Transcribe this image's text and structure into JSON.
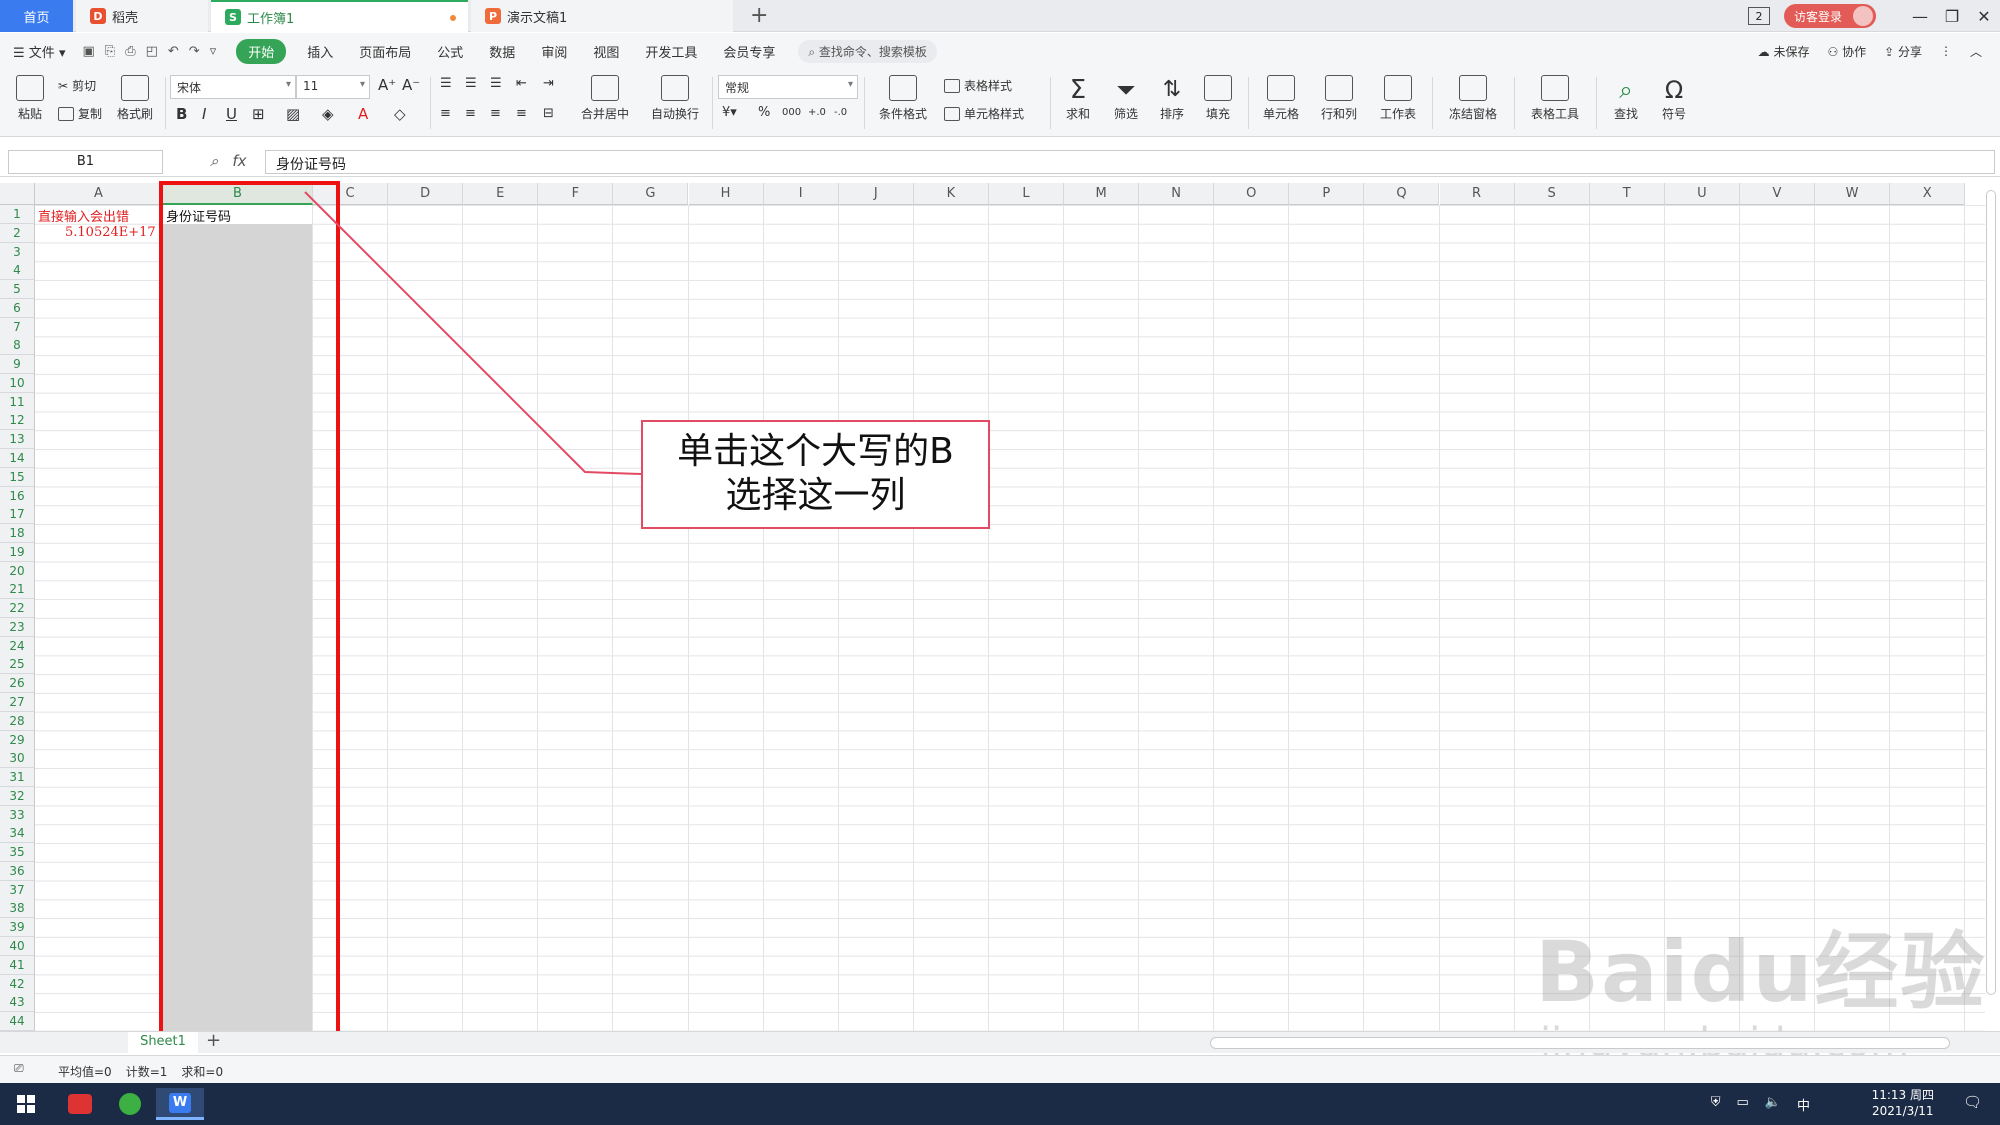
{
  "tabs": {
    "home": "首页",
    "daoke": "稻壳",
    "workbook": "工作簿1",
    "presentation": "演示文稿1",
    "add": "+"
  },
  "window": {
    "badge": "2",
    "login": "访客登录",
    "minimize": "—",
    "restore": "❐",
    "close": "✕"
  },
  "menu": {
    "file": "文件",
    "items": [
      "开始",
      "插入",
      "页面布局",
      "公式",
      "数据",
      "审阅",
      "视图",
      "开发工具",
      "会员专享"
    ],
    "search": "查找命令、搜索模板",
    "unsaved": "未保存",
    "collab": "协作",
    "share": "分享"
  },
  "ribbon": {
    "paste": "粘贴",
    "cut": "剪切",
    "copy": "复制",
    "format_painter": "格式刷",
    "font_name": "宋体",
    "font_size": "11",
    "number_format": "常规",
    "merge_center": "合并居中",
    "wrap": "自动换行",
    "cond_format": "条件格式",
    "table_style": "表格样式",
    "cell_style": "单元格样式",
    "sum": "求和",
    "filter": "筛选",
    "sort": "排序",
    "fill": "填充",
    "cell": "单元格",
    "row_col": "行和列",
    "worksheet": "工作表",
    "freeze": "冻结窗格",
    "table_tools": "表格工具",
    "find": "查找",
    "symbol": "符号",
    "bold": "B",
    "italic": "I",
    "underline": "U"
  },
  "formula_bar": {
    "cell_ref": "B1",
    "fx": "fx",
    "content": "身份证号码"
  },
  "grid": {
    "columns": [
      "A",
      "B",
      "C",
      "D",
      "E",
      "F",
      "G",
      "H",
      "I",
      "J",
      "K",
      "L",
      "M",
      "N",
      "O",
      "P",
      "Q",
      "R",
      "S",
      "T",
      "U",
      "V",
      "W",
      "X"
    ],
    "selected_column": "B",
    "row_count": 44,
    "cells": {
      "A1": "直接输入会出错",
      "A2": "5.10524E+17",
      "B1": "身份证号码"
    }
  },
  "annotation": {
    "line1": "单击这个大写的B",
    "line2": "选择这一列"
  },
  "sheets": {
    "active": "Sheet1",
    "add": "+"
  },
  "status": {
    "avg": "平均值=0",
    "count": "计数=1",
    "sum": "求和=0"
  },
  "taskbar": {
    "time": "11:13 周四",
    "date": "2021/3/11",
    "ime": "中"
  },
  "watermark": {
    "brand": "Baidu经验",
    "url": "jingyan.baidu.com"
  },
  "colors": {
    "accent_green": "#35a457",
    "highlight_red": "#ee1111",
    "callout_border": "#e34a63"
  }
}
